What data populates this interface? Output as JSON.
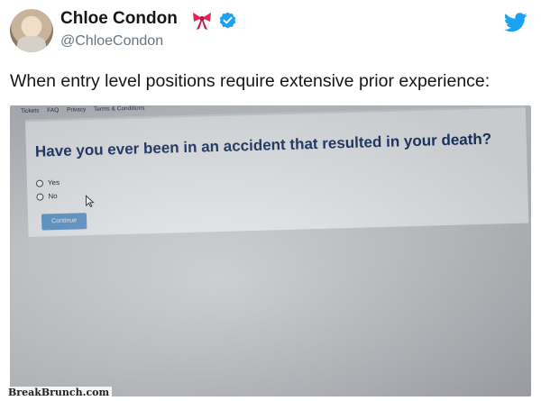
{
  "tweet": {
    "display_name": "Chloe Condon",
    "handle": "@ChloeCondon",
    "text": "When entry level positions require extensive prior experience:",
    "icons": {
      "name_emoji": "ribbon-bow-icon",
      "verified": "verified-badge-icon",
      "brand": "twitter-bird-icon"
    },
    "colors": {
      "verified": "#1da1f2",
      "bow": "#e0245e",
      "brand": "#1da1f2"
    }
  },
  "photo": {
    "nav_links": [
      "Tickets",
      "FAQ",
      "Privacy",
      "Terms & Conditions"
    ],
    "question": "Have you ever been in an accident that resulted in your death?",
    "options": [
      "Yes",
      "No"
    ],
    "continue_label": "Continue",
    "colors": {
      "question": "#1c3566",
      "button": "#5a93c8"
    }
  },
  "watermark": "BreakBrunch.com"
}
